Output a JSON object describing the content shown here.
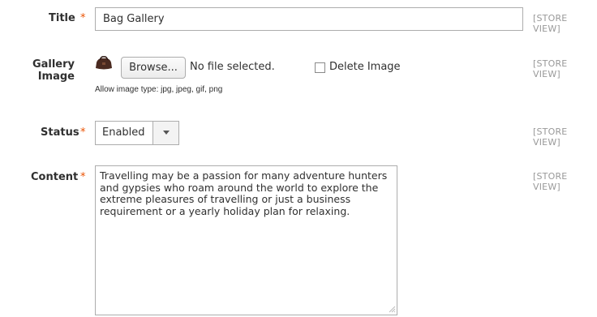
{
  "fields": {
    "title": {
      "label": "Title",
      "required_mark": "*",
      "value": "Bag Gallery",
      "scope": "[STORE VIEW]"
    },
    "gallery_image": {
      "label": "Gallery Image",
      "browse_label": "Browse...",
      "file_status": "No file selected.",
      "delete_label": "Delete Image",
      "delete_checked": false,
      "note": "Allow image type: jpg, jpeg, gif, png",
      "scope": "[STORE VIEW]",
      "thumbnail_icon": "bag-thumbnail-icon"
    },
    "status": {
      "label": "Status",
      "required_mark": "*",
      "value": "Enabled",
      "scope": "[STORE VIEW]"
    },
    "content": {
      "label": "Content",
      "required_mark": "*",
      "value": "Travelling may be a passion for many adventure hunters and gypsies who roam around the world to explore the extreme pleasures of travelling or just a business requirement or a yearly holiday plan for relaxing.",
      "scope": "[STORE VIEW]"
    }
  },
  "colors": {
    "required": "#eb5202",
    "scope_text": "#999999",
    "border": "#adadad"
  }
}
